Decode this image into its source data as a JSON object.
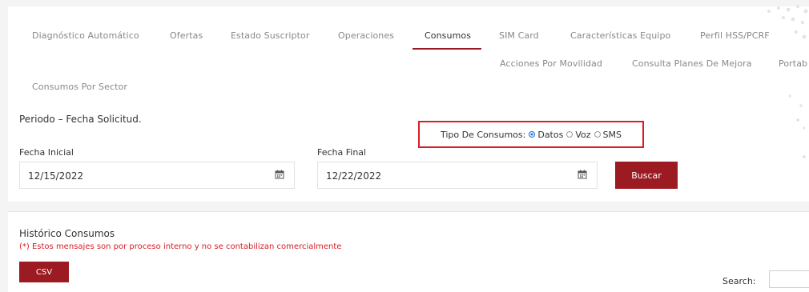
{
  "tabs": {
    "row1": [
      {
        "label": "Diagnóstico Automático"
      },
      {
        "label": "Ofertas"
      },
      {
        "label": "Estado Suscriptor"
      },
      {
        "label": "Operaciones"
      },
      {
        "label": "Consumos"
      },
      {
        "label": "SIM Card"
      },
      {
        "label": "Características Equipo"
      },
      {
        "label": "Perfil HSS/PCRF"
      }
    ],
    "row2": [
      {
        "label": "Acciones Por Movilidad"
      },
      {
        "label": "Consulta Planes De Mejora"
      },
      {
        "label": "Portab"
      }
    ],
    "row3": [
      {
        "label": "Consumos Por Sector"
      }
    ],
    "active": "Consumos"
  },
  "form": {
    "periodo": "Periodo – Fecha Solicitud.",
    "fecha_inicial_label": "Fecha Inicial",
    "fecha_inicial_value": "12/15/2022",
    "fecha_final_label": "Fecha Final",
    "fecha_final_value": "12/22/2022",
    "buscar_label": "Buscar",
    "tipo_label": "Tipo De Consumos:",
    "tipo_options": [
      "Datos",
      "Voz",
      "SMS"
    ],
    "tipo_selected": "Datos"
  },
  "historico": {
    "title": "Histórico Consumos",
    "note": "(*) Estos mensajes son por proceso interno y no se contabilizan comercialmente",
    "csv_label": "CSV",
    "search_label": "Search:"
  },
  "colors": {
    "accent": "#9c1b22",
    "highlight_border": "#d61f26",
    "radio_selected": "#1a73e8"
  }
}
